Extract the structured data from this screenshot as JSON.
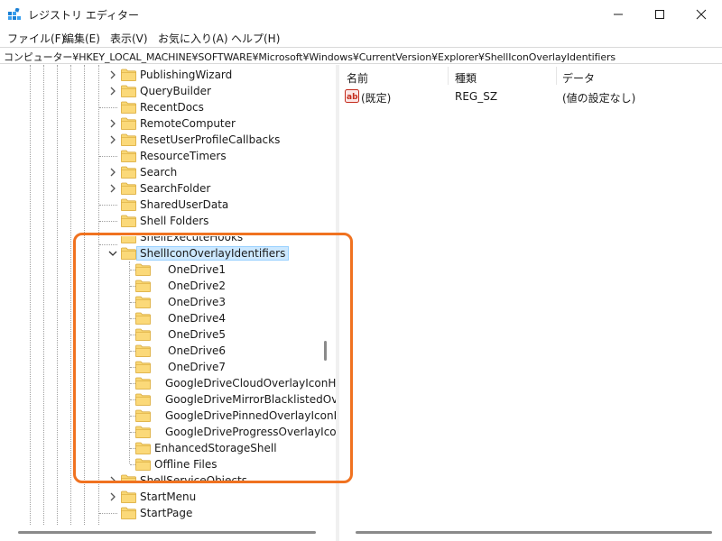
{
  "window": {
    "title": "レジストリ エディター"
  },
  "menu": [
    {
      "label": "ファイル(F)"
    },
    {
      "label": "編集(E)"
    },
    {
      "label": "表示(V)"
    },
    {
      "label": "お気に入り(A)"
    },
    {
      "label": "ヘルプ(H)"
    }
  ],
  "address": {
    "path": "コンピューター¥HKEY_LOCAL_MACHINE¥SOFTWARE¥Microsoft¥Windows¥CurrentVersion¥Explorer¥ShellIconOverlayIdentifiers"
  },
  "tree": {
    "items": [
      {
        "label": "PublishingWizard",
        "expandable": true,
        "level": 1
      },
      {
        "label": "QueryBuilder",
        "expandable": true,
        "level": 1
      },
      {
        "label": "RecentDocs",
        "expandable": false,
        "level": 1
      },
      {
        "label": "RemoteComputer",
        "expandable": true,
        "level": 1
      },
      {
        "label": "ResetUserProfileCallbacks",
        "expandable": true,
        "level": 1
      },
      {
        "label": "ResourceTimers",
        "expandable": false,
        "level": 1
      },
      {
        "label": "Search",
        "expandable": true,
        "level": 1
      },
      {
        "label": "SearchFolder",
        "expandable": true,
        "level": 1
      },
      {
        "label": "SharedUserData",
        "expandable": false,
        "level": 1
      },
      {
        "label": "Shell Folders",
        "expandable": false,
        "level": 1
      },
      {
        "label": "ShellExecuteHooks",
        "expandable": false,
        "level": 1
      },
      {
        "label": "ShellIconOverlayIdentifiers",
        "expandable": true,
        "expanded": true,
        "selected": true,
        "level": 1
      },
      {
        "label": "OneDrive1",
        "expandable": false,
        "level": 2
      },
      {
        "label": "OneDrive2",
        "expandable": false,
        "level": 2
      },
      {
        "label": "OneDrive3",
        "expandable": false,
        "level": 2
      },
      {
        "label": "OneDrive4",
        "expandable": false,
        "level": 2
      },
      {
        "label": "OneDrive5",
        "expandable": false,
        "level": 2
      },
      {
        "label": "OneDrive6",
        "expandable": false,
        "level": 2
      },
      {
        "label": "OneDrive7",
        "expandable": false,
        "level": 2
      },
      {
        "label": "GoogleDriveCloudOverlayIconH",
        "expandable": false,
        "level": 2
      },
      {
        "label": "GoogleDriveMirrorBlacklistedOv",
        "expandable": false,
        "level": 2
      },
      {
        "label": "GoogleDrivePinnedOverlayIconH",
        "expandable": false,
        "level": 2
      },
      {
        "label": "GoogleDriveProgressOverlayIcor",
        "expandable": false,
        "level": 2
      },
      {
        "label": "EnhancedStorageShell",
        "expandable": false,
        "level": 2
      },
      {
        "label": "Offline Files",
        "expandable": false,
        "level": 2
      },
      {
        "label": "ShellServiceObjects",
        "expandable": true,
        "level": 1
      },
      {
        "label": "StartMenu",
        "expandable": true,
        "level": 1
      },
      {
        "label": "StartPage",
        "expandable": false,
        "level": 1
      }
    ]
  },
  "list": {
    "columns": [
      "名前",
      "種類",
      "データ"
    ],
    "rows": [
      {
        "name": "(既定)",
        "type": "REG_SZ",
        "data": "(値の設定なし)"
      }
    ]
  },
  "colors": {
    "highlight_border": "#f07220",
    "selection_bg": "#cce8ff",
    "folder": "#f8d775"
  }
}
